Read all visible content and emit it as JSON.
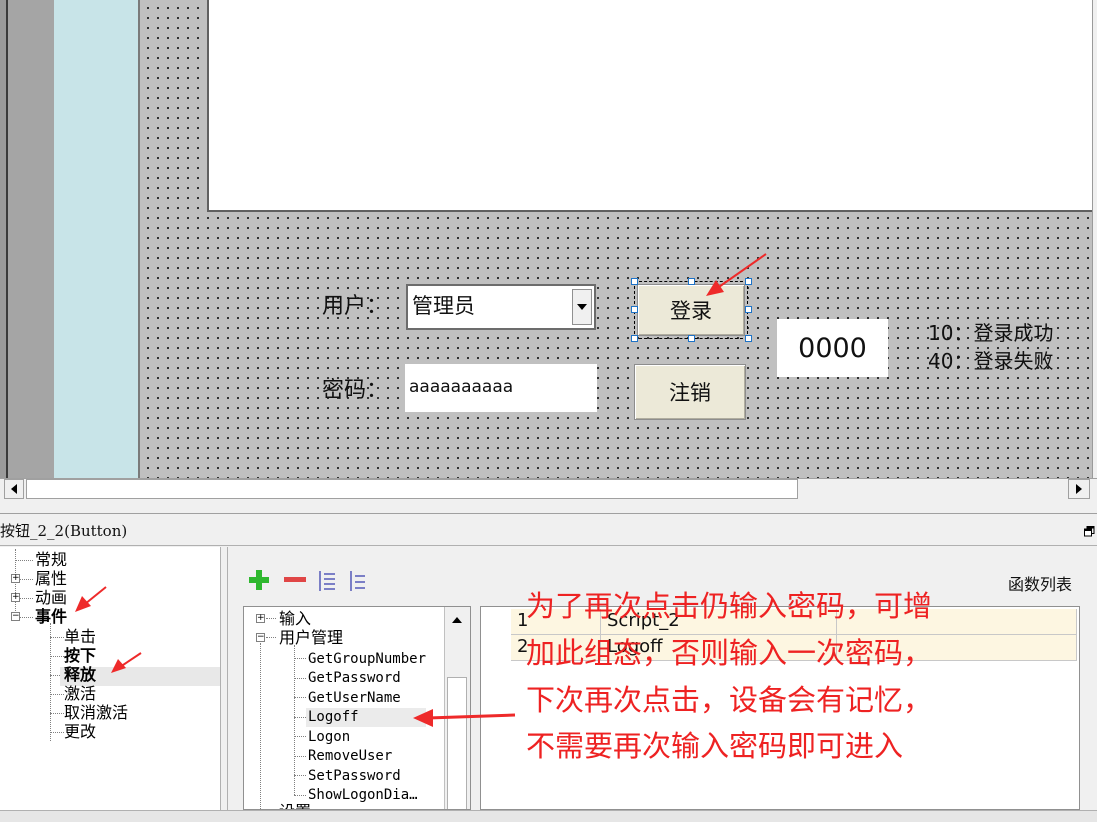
{
  "canvas": {
    "combo_label": "用户：",
    "combo_value": "管理员",
    "password_label": "密码：",
    "password_value": "aaaaaaaaaa",
    "login_button": "登录",
    "logout_button": "注销",
    "status_value": "0000",
    "status_note_1": "10：登录成功",
    "status_note_2": "40：登录失败"
  },
  "properties": {
    "title": "按钮_2_2(Button)",
    "categories": [
      {
        "label": "常规",
        "expandable": false
      },
      {
        "label": "属性",
        "expandable": true
      },
      {
        "label": "动画",
        "expandable": true
      },
      {
        "label": "事件",
        "expandable": true,
        "bold": true
      }
    ],
    "events": [
      {
        "label": "单击",
        "bold": false
      },
      {
        "label": "按下",
        "bold": true
      },
      {
        "label": "释放",
        "bold": true,
        "selected": true
      },
      {
        "label": "激活",
        "bold": false
      },
      {
        "label": "取消激活",
        "bold": false
      },
      {
        "label": "更改",
        "bold": false
      }
    ],
    "function_list_label": "函数列表",
    "function_tree": {
      "group_input": "输入",
      "group_user": "用户管理",
      "functions": [
        "GetGroupNumber",
        "GetPassword",
        "GetUserName",
        "Logoff",
        "Logon",
        "RemoveUser",
        "SetPassword",
        "ShowLogonDia…"
      ],
      "cut_off_group": "设置"
    },
    "script_table": [
      {
        "index": "1",
        "name": "Script_2"
      },
      {
        "index": "2",
        "name": "Logoff"
      }
    ]
  },
  "annotation": {
    "lines": [
      "为了再次点击仍输入密码，可增",
      "加此组态，否则输入一次密码，",
      "下次再次点击，设备会有记忆，",
      "不需要再次输入密码即可进入"
    ],
    "color": "#ee2222"
  },
  "icons": [
    "plus-icon",
    "minus-icon",
    "indent-icon",
    "outdent-icon",
    "scroll-left-icon",
    "scroll-right-icon",
    "restore-icon",
    "dropdown-arrow-icon"
  ]
}
